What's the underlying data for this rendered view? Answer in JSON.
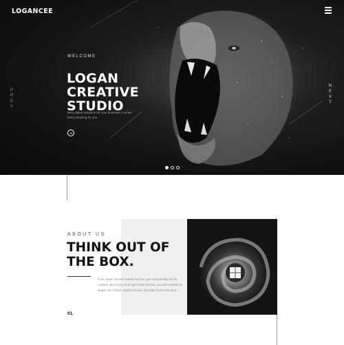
{
  "header": {
    "logo": "LOGANCEE",
    "menu_icon": "hamburger-menu-icon"
  },
  "hero": {
    "welcome": "WELCOME",
    "title_lines": [
      "LOGAN",
      "CREATIVE",
      "STUDIO"
    ],
    "description": "Best digital solutions for your business ! Let we bring amazing for you.",
    "scroll_icon": "chevron-down-icon",
    "prev_label": "PREV",
    "next_label": "NEXT",
    "slides": 3,
    "active_slide": 1
  },
  "about": {
    "label": "ABOUT US",
    "title_lines": [
      "THINK OUT OF",
      "THE BOX."
    ],
    "text": "If you never venture outside the box, you will probably not be creative. But, if you never get inside the box, you will certainly be stupid. Don't think outside the box, think like there is No Box !",
    "number": "01."
  }
}
